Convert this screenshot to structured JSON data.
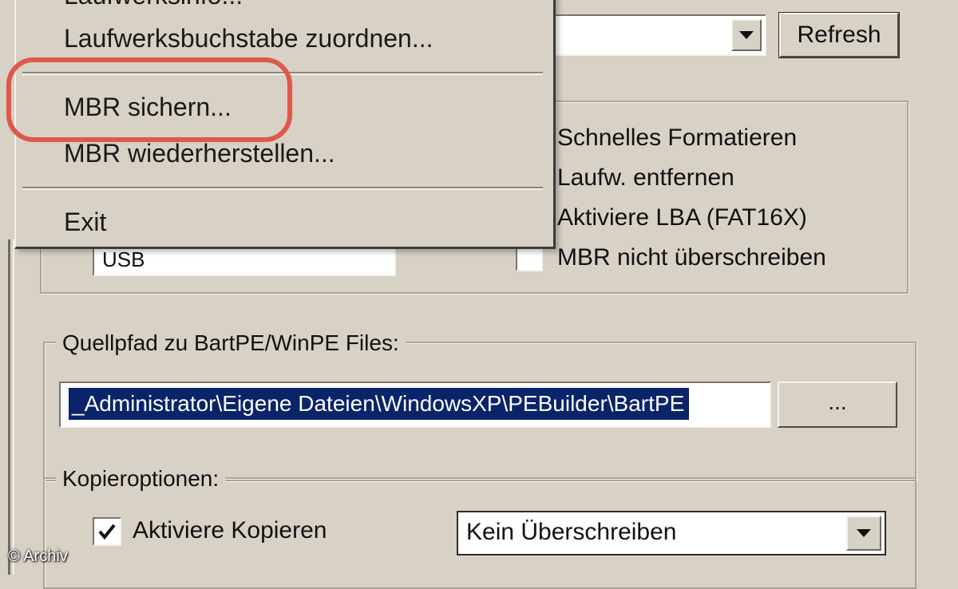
{
  "menu": {
    "items": [
      {
        "label": "Laufwerksinfo..."
      },
      {
        "label": "Laufwerksbuchstabe zuordnen..."
      },
      {
        "label": "MBR sichern..."
      },
      {
        "label": "MBR wiederherstellen..."
      },
      {
        "label": "Exit"
      }
    ]
  },
  "drive": {
    "value": "",
    "refresh_label": "Refresh"
  },
  "options": {
    "quick_format": "Schnelles Formatieren",
    "remove_drive": "Laufw. entfernen",
    "enable_lba": "Aktiviere LBA (FAT16X)",
    "no_mbr_overwrite": "MBR nicht überschreiben",
    "volume_label": "USB"
  },
  "source": {
    "legend": "Quellpfad zu BartPE/WinPE Files:",
    "path": "_Administrator\\Eigene Dateien\\WindowsXP\\PEBuilder\\BartPE",
    "browse_label": "..."
  },
  "copy": {
    "legend": "Kopieroptionen:",
    "enable_copy_label": "Aktiviere Kopieren",
    "enable_copy_checked": true,
    "overwrite_value": "Kein Überschreiben"
  },
  "copyright": "© Archiv",
  "colors": {
    "highlight_ring": "#e0584a",
    "selection": "#0a246a",
    "window_bg": "#d7d1c6"
  }
}
